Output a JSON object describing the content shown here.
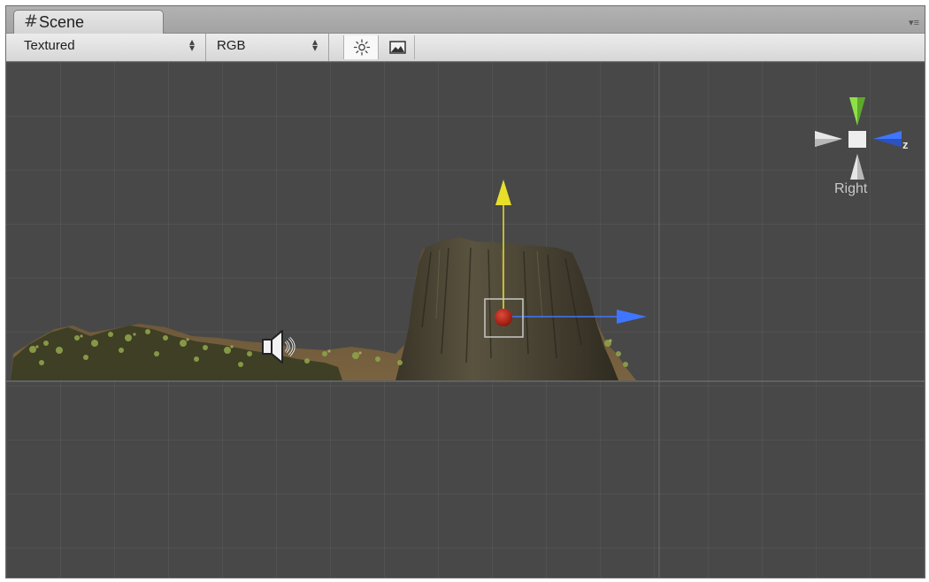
{
  "tab": {
    "icon": "grid-hash-icon",
    "icon_glyph": "#",
    "label": "Scene",
    "menu_icon": "panel-menu-icon",
    "menu_glyph": "▾≡"
  },
  "toolbar": {
    "render_mode": "Textured",
    "channel": "RGB",
    "lighting_icon": "sun-icon",
    "image_icon": "image-icon"
  },
  "viewport": {
    "gizmo_label": "Right",
    "gizmo_axis_label": "z",
    "gizmo_arrows": [
      "green-y-cone",
      "blue-z-cone",
      "white-neg-z-cone",
      "white-neg-y-cone"
    ],
    "scene_objects": [
      "terrain-volcano",
      "audio-source-icon",
      "selected-object-handle"
    ],
    "colors": {
      "axis_y": "#e8df2a",
      "axis_z": "#3f76ff",
      "gizmo_green": "#8ee04a",
      "background": "#484848"
    }
  }
}
